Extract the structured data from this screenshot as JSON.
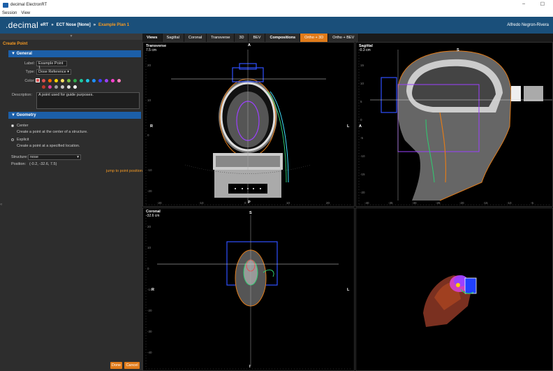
{
  "window": {
    "title": "decimal ElectronRT",
    "minimize": "–",
    "maximize": "☐"
  },
  "menu": [
    "Session",
    "View"
  ],
  "header": {
    "logo": ".decimal",
    "crumbs": [
      "eRT",
      "ECT Nose [None]",
      "Example Plan 1"
    ],
    "separator": "»",
    "user": "Alfredo Negron-Rivera"
  },
  "left_panel": {
    "collapse_glyph": "▼",
    "title": "Create Point",
    "general": {
      "header": "▼ General",
      "label_lbl": "Label:",
      "label_value": "Example Point 1",
      "type_lbl": "Type:",
      "type_value": "Dose Reference",
      "color_lbl": "Color:",
      "description_lbl": "Description:",
      "description_value": "A point used for guide purposes.",
      "swatches_row1": [
        "#e05050",
        "#ff6a00",
        "#ffd400",
        "#ffe066",
        "#7ac143",
        "#2ea84b",
        "#1ec8a0",
        "#1ec8e6",
        "#1e90ff",
        "#4040ff",
        "#9b40ff",
        "#ff40d0",
        "#ff80c0"
      ],
      "swatches_row2": [
        "#c0392b",
        "#e040a0",
        "#a0a0a0",
        "#c8c8c8",
        "#e0e0e0",
        "#ffffff"
      ]
    },
    "geometry": {
      "header": "▼ Geometry",
      "center_label": "Center",
      "center_desc": "Create a point at the center of a structure.",
      "explicit_label": "Explicit",
      "explicit_desc": "Create a point at a specified location.",
      "structure_lbl": "Structure:",
      "structure_value": "nose",
      "position_lbl": "Position:",
      "position_value": "(-0.2, -32.6, 7.5)",
      "jump_link": "jump to point position"
    },
    "buttons": {
      "done": "Done",
      "cancel": "Cancel"
    },
    "left_edge_glyph": "«"
  },
  "view_tabs": [
    "Views",
    "Sagittal",
    "Coronal",
    "Transverse",
    "3D",
    "BEV",
    "Compositions",
    "Ortho + 3D",
    "Ortho + BEV"
  ],
  "active_tab": "Ortho + 3D",
  "viewports": {
    "transverse": {
      "label": "Transverse",
      "sub": "7.5 cm",
      "top": "A",
      "bottom": "P",
      "left": "R",
      "right": "L",
      "ruler_bottom": [
        "-20",
        "-10",
        "0",
        "10",
        "20"
      ],
      "ruler_left": [
        "20",
        "10",
        "0",
        "-10",
        "-20"
      ]
    },
    "sagittal": {
      "label": "Sagittal",
      "sub": "-0.3 cm",
      "top": "S",
      "left": "A",
      "ruler_bottom": [
        "-40",
        "-35",
        "-30",
        "-25",
        "-20",
        "-15",
        "-10",
        "-5"
      ],
      "ruler_left": [
        "15",
        "10",
        "5",
        "0",
        "-5",
        "-10",
        "-15",
        "-20"
      ]
    },
    "coronal": {
      "label": "Coronal",
      "sub": "-32.6 cm",
      "top": "S",
      "bottom": "I",
      "left": "R",
      "right": "L",
      "ruler_left": [
        "20",
        "10",
        "0",
        "-10",
        "-20",
        "-30",
        "-40"
      ]
    }
  }
}
